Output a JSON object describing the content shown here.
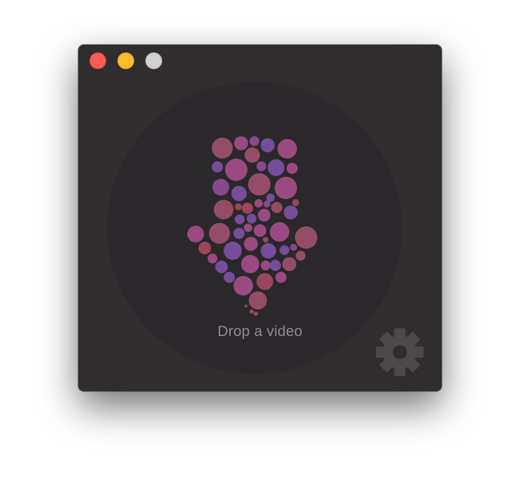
{
  "window": {
    "controls": [
      {
        "name": "close-button",
        "color": "#fc5b57"
      },
      {
        "name": "minimize-button",
        "color": "#fdbc2f"
      },
      {
        "name": "zoom-button",
        "color": "#d0d0d0"
      }
    ]
  },
  "drop_zone": {
    "label": "Drop a video",
    "icon": "bubble-down-arrow-icon"
  },
  "settings": {
    "icon": "gear-icon"
  },
  "colors": {
    "window_bg": "#2f2d2e",
    "drop_zone_bg": "#2a282a",
    "label": "#8e8b8d",
    "gear": "#4b494a",
    "bubble_palette": [
      "#9b4f6a",
      "#a04c86",
      "#7a4fa0",
      "#8c4a90",
      "#a0485e"
    ]
  }
}
